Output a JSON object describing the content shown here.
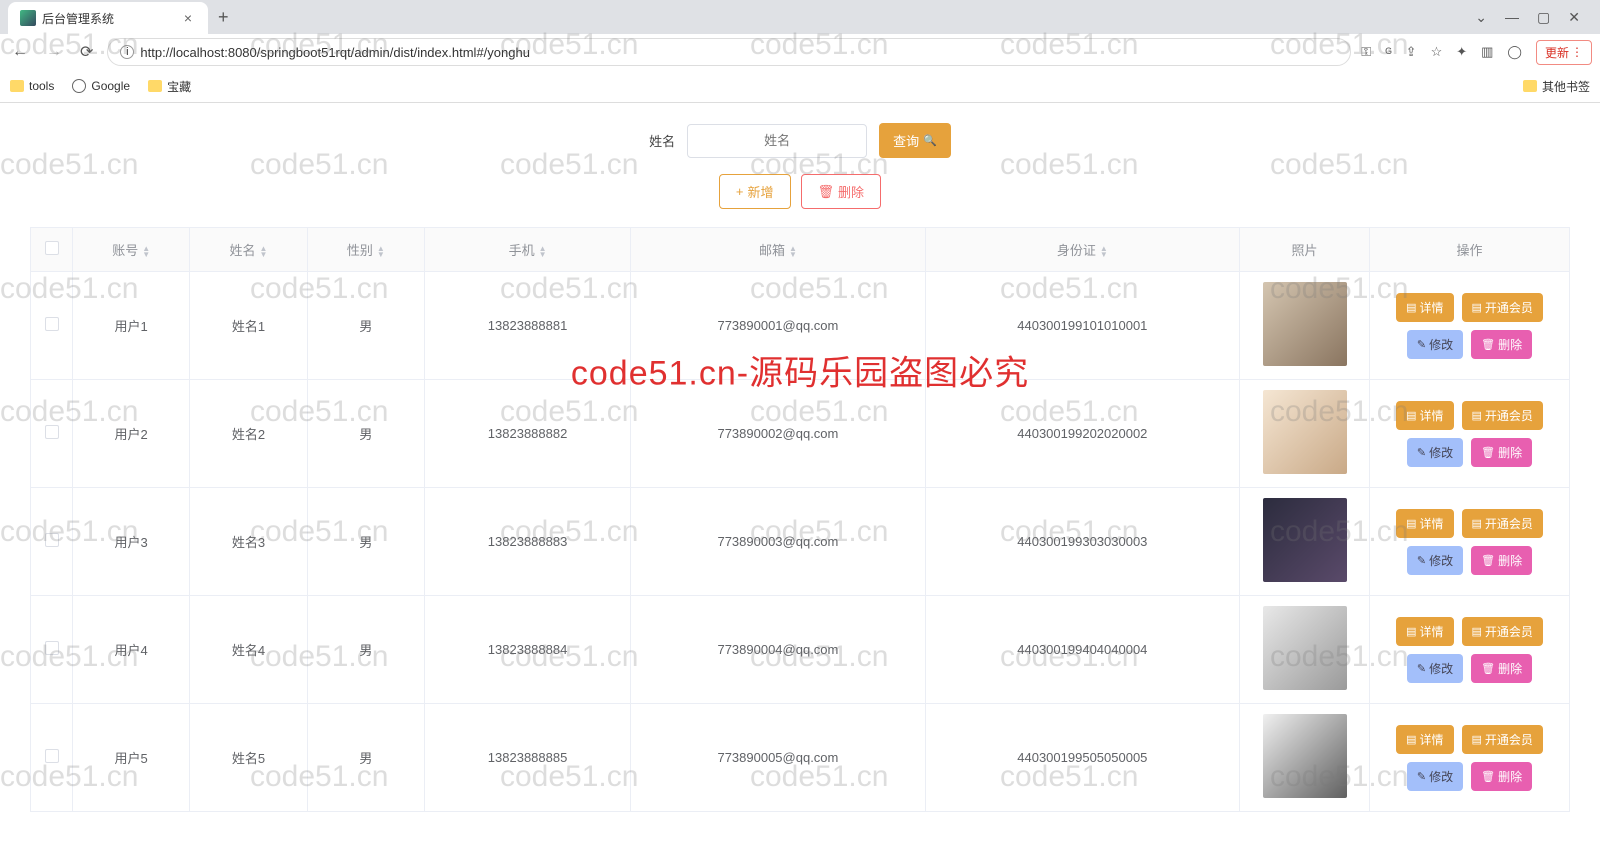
{
  "browser": {
    "tab_title": "后台管理系统",
    "url": "http://localhost:8080/springboot51rqt/admin/dist/index.html#/yonghu",
    "update_label": "更新",
    "bookmarks": {
      "tools": "tools",
      "google": "Google",
      "treasure": "宝藏",
      "other": "其他书签"
    }
  },
  "search": {
    "label": "姓名",
    "placeholder": "姓名",
    "query_btn": "查询"
  },
  "actions": {
    "add": "新增",
    "delete": "删除"
  },
  "columns": {
    "account": "账号",
    "name": "姓名",
    "gender": "性别",
    "phone": "手机",
    "email": "邮箱",
    "idcard": "身份证",
    "photo": "照片",
    "operation": "操作"
  },
  "op_labels": {
    "detail": "详情",
    "open_vip": "开通会员",
    "edit": "修改",
    "delete": "删除"
  },
  "rows": [
    {
      "account": "用户1",
      "name": "姓名1",
      "gender": "男",
      "phone": "13823888881",
      "email": "773890001@qq.com",
      "idcard": "440300199101010001"
    },
    {
      "account": "用户2",
      "name": "姓名2",
      "gender": "男",
      "phone": "13823888882",
      "email": "773890002@qq.com",
      "idcard": "440300199202020002"
    },
    {
      "account": "用户3",
      "name": "姓名3",
      "gender": "男",
      "phone": "13823888883",
      "email": "773890003@qq.com",
      "idcard": "440300199303030003"
    },
    {
      "account": "用户4",
      "name": "姓名4",
      "gender": "男",
      "phone": "13823888884",
      "email": "773890004@qq.com",
      "idcard": "440300199404040004"
    },
    {
      "account": "用户5",
      "name": "姓名5",
      "gender": "男",
      "phone": "13823888885",
      "email": "773890005@qq.com",
      "idcard": "440300199505050005"
    }
  ],
  "watermark": {
    "repeat": "code51.cn",
    "center": "code51.cn-源码乐园盗图必究"
  }
}
